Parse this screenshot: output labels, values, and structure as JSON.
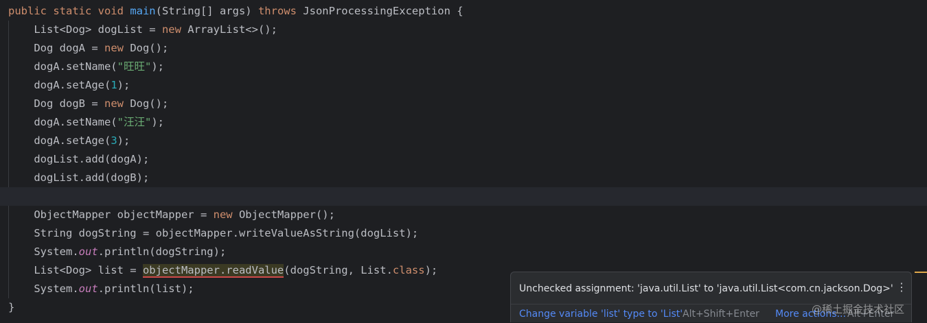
{
  "code_lines": [
    [
      {
        "t": "public static void ",
        "c": "kw"
      },
      {
        "t": "main",
        "c": "fn"
      },
      {
        "t": "(String[] args) ",
        "c": ""
      },
      {
        "t": "throws ",
        "c": "kw"
      },
      {
        "t": "JsonProcessingException {",
        "c": ""
      }
    ],
    [
      {
        "t": "    List<Dog> dogList = ",
        "c": ""
      },
      {
        "t": "new ",
        "c": "kw"
      },
      {
        "t": "ArrayList<>();",
        "c": ""
      }
    ],
    [
      {
        "t": "    Dog dogA = ",
        "c": ""
      },
      {
        "t": "new ",
        "c": "kw"
      },
      {
        "t": "Dog();",
        "c": ""
      }
    ],
    [
      {
        "t": "    dogA.setName(",
        "c": ""
      },
      {
        "t": "\"旺旺\"",
        "c": "str"
      },
      {
        "t": ");",
        "c": ""
      }
    ],
    [
      {
        "t": "    dogA.setAge(",
        "c": ""
      },
      {
        "t": "1",
        "c": "num"
      },
      {
        "t": ");",
        "c": ""
      }
    ],
    [
      {
        "t": "    Dog dogB = ",
        "c": ""
      },
      {
        "t": "new ",
        "c": "kw"
      },
      {
        "t": "Dog();",
        "c": ""
      }
    ],
    [
      {
        "t": "    dogA.setName(",
        "c": ""
      },
      {
        "t": "\"汪汪\"",
        "c": "str"
      },
      {
        "t": ");",
        "c": ""
      }
    ],
    [
      {
        "t": "    dogA.setAge(",
        "c": ""
      },
      {
        "t": "3",
        "c": "num"
      },
      {
        "t": ");",
        "c": ""
      }
    ],
    [
      {
        "t": "    dogList.add(dogA);",
        "c": ""
      }
    ],
    [
      {
        "t": "    dogList.add(dogB);",
        "c": ""
      }
    ],
    [
      {
        "t": "",
        "c": ""
      }
    ],
    [
      {
        "t": "    ObjectMapper objectMapper = ",
        "c": ""
      },
      {
        "t": "new ",
        "c": "kw"
      },
      {
        "t": "ObjectMapper();",
        "c": ""
      }
    ],
    [
      {
        "t": "    String dogString = objectMapper.writeValueAsString(dogList);",
        "c": ""
      }
    ],
    [
      {
        "t": "    System.",
        "c": ""
      },
      {
        "t": "out",
        "c": "it"
      },
      {
        "t": ".println(dogString);",
        "c": ""
      }
    ],
    [
      {
        "t": "    List<Dog> list = ",
        "c": ""
      },
      {
        "t": "objectMapper.readValue",
        "c": "warn"
      },
      {
        "t": "(dogString, List.",
        "c": ""
      },
      {
        "t": "class",
        "c": "kw"
      },
      {
        "t": ");",
        "c": ""
      }
    ],
    [
      {
        "t": "    System.",
        "c": ""
      },
      {
        "t": "out",
        "c": "it"
      },
      {
        "t": ".println(list);",
        "c": ""
      }
    ],
    [
      {
        "t": "}",
        "c": ""
      }
    ]
  ],
  "caret_line": 10,
  "popup": {
    "message": "Unchecked assignment: 'java.util.List' to 'java.util.List<com.cn.jackson.Dog>'",
    "menu_glyph": "⋮",
    "fix_label": "Change variable 'list' type to 'List'",
    "fix_shortcut": "Alt+Shift+Enter",
    "more_label": "More actions...",
    "more_shortcut": "Alt+Enter"
  },
  "watermark": "@稀土掘金技术社区"
}
